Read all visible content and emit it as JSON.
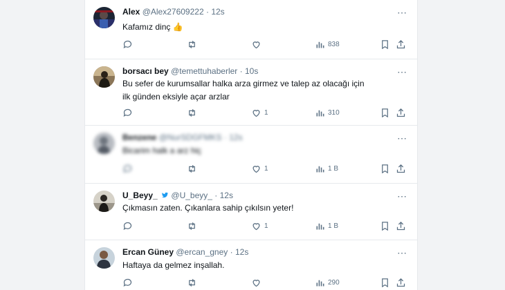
{
  "tweets": [
    {
      "name": "Alex",
      "handle": "@Alex27609222",
      "time": "12s",
      "text": "Kafamız dinç 👍",
      "likes": "",
      "views": "838",
      "views_icon": "bar-chart-icon"
    },
    {
      "name": "borsacı bey",
      "handle": "@temettuhaberler",
      "time": "10s",
      "text": "Bu sefer de kurumsallar halka arza girmez ve talep az olacağı için ilk günden eksiyle açar arzlar",
      "likes": "1",
      "views": "310"
    },
    {
      "name": "Benzene",
      "handle": "@NurSDGFMKS",
      "time": "12s",
      "text": "Bicarim halk a arz hiç",
      "likes": "1",
      "views": "1 B"
    },
    {
      "name": "U_Beyy_",
      "handle": "@U_beyy_",
      "time": "12s",
      "text": "Çıkmasın zaten. Çıkanlara sahip çıkılsın yeter!",
      "likes": "1",
      "views": "1 B"
    },
    {
      "name": "Ercan Güney",
      "handle": "@ercan_gney",
      "time": "12s",
      "text": "Haftaya da gelmez inşallah.",
      "likes": "",
      "views": "290"
    }
  ],
  "separator": "·",
  "colors": {
    "text": "#0f1419",
    "secondary": "#5b7083",
    "verified": "#1d9bf0",
    "border": "#e6e9ec"
  }
}
